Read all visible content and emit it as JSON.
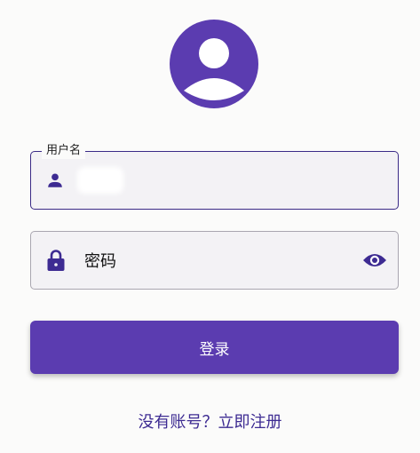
{
  "login": {
    "username_label": "用户名",
    "username_value": "",
    "password_placeholder": "密码",
    "login_button": "登录",
    "register_link": "没有账号？立即注册"
  },
  "icons": {
    "avatar": "user-avatar-icon",
    "username": "person-icon",
    "password": "lock-icon",
    "toggle": "eye-icon"
  },
  "colors": {
    "primary": "#5b3cb0",
    "link": "#3d2b92",
    "focused_border": "#3a2a86"
  }
}
